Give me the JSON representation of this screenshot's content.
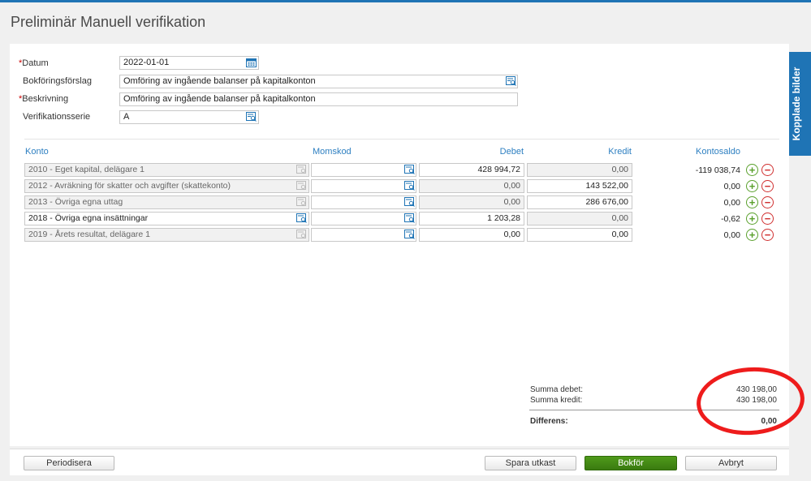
{
  "page": {
    "title": "Preliminär Manuell verifikation"
  },
  "side_tab": {
    "label": "Kopplade bilder"
  },
  "form": {
    "required_marker": "*",
    "datum": {
      "label": "Datum",
      "value": "2022-01-01"
    },
    "bokforingsforslag": {
      "label": "Bokföringsförslag",
      "value": "Omföring av ingående balanser på kapitalkonton"
    },
    "beskrivning": {
      "label": "Beskrivning",
      "value": "Omföring av ingående balanser på kapitalkonton"
    },
    "verifikationsserie": {
      "label": "Verifikationsserie",
      "value": "A"
    }
  },
  "table": {
    "headers": {
      "konto": "Konto",
      "momskod": "Momskod",
      "debet": "Debet",
      "kredit": "Kredit",
      "kontosaldo": "Kontosaldo"
    },
    "rows": [
      {
        "konto": "2010 - Eget kapital, delägare 1",
        "momskod": "",
        "debet": "428 994,72",
        "kredit": "0,00",
        "saldo": "-119 038,74"
      },
      {
        "konto": "2012 - Avräkning för skatter och avgifter (skattekonto)",
        "momskod": "",
        "debet": "0,00",
        "kredit": "143 522,00",
        "saldo": "0,00"
      },
      {
        "konto": "2013 - Övriga egna uttag",
        "momskod": "",
        "debet": "0,00",
        "kredit": "286 676,00",
        "saldo": "0,00"
      },
      {
        "konto": "2018 - Övriga egna insättningar",
        "momskod": "",
        "debet": "1 203,28",
        "kredit": "0,00",
        "saldo": "-0,62"
      },
      {
        "konto": "2019 - Årets resultat, delägare 1",
        "momskod": "",
        "debet": "0,00",
        "kredit": "0,00",
        "saldo": "0,00"
      }
    ],
    "row_actions": {
      "add": "+",
      "remove": "−"
    }
  },
  "summary": {
    "summa_debet": {
      "label": "Summa debet:",
      "value": "430 198,00"
    },
    "summa_kredit": {
      "label": "Summa kredit:",
      "value": "430 198,00"
    },
    "differens": {
      "label": "Differens:",
      "value": "0,00"
    }
  },
  "footer": {
    "periodisera": "Periodisera",
    "spara_utkast": "Spara utkast",
    "bokfor": "Bokför",
    "avbryt": "Avbryt"
  },
  "colors": {
    "accent": "#1f74b5",
    "primary_button": "#4a8f1a",
    "annotation": "#ee1c1c"
  }
}
